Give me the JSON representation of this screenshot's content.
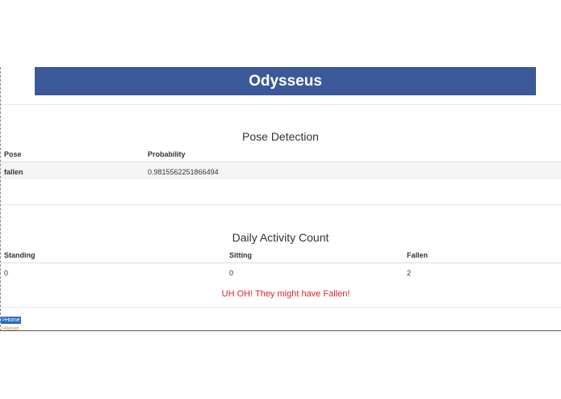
{
  "header": {
    "title": "Odysseus"
  },
  "pose_detection": {
    "title": "Pose Detection",
    "columns": [
      "Pose",
      "Probability"
    ],
    "rows": [
      {
        "pose": "fallen",
        "probability": "0.9815562251866494"
      }
    ]
  },
  "daily_activity": {
    "title": "Daily Activity Count",
    "columns": [
      "Standing",
      "Sitting",
      "Fallen"
    ],
    "rows": [
      {
        "standing": "0",
        "sitting": "0",
        "fallen": "2"
      }
    ]
  },
  "alert": {
    "message": "UH OH! They might have Fallen!",
    "color": "#d9232d"
  },
  "links": {
    "home": ">Home",
    "reset": ">Reset"
  },
  "colors": {
    "header_bg": "#3b5998",
    "link_highlight": "#2a6ac7"
  }
}
